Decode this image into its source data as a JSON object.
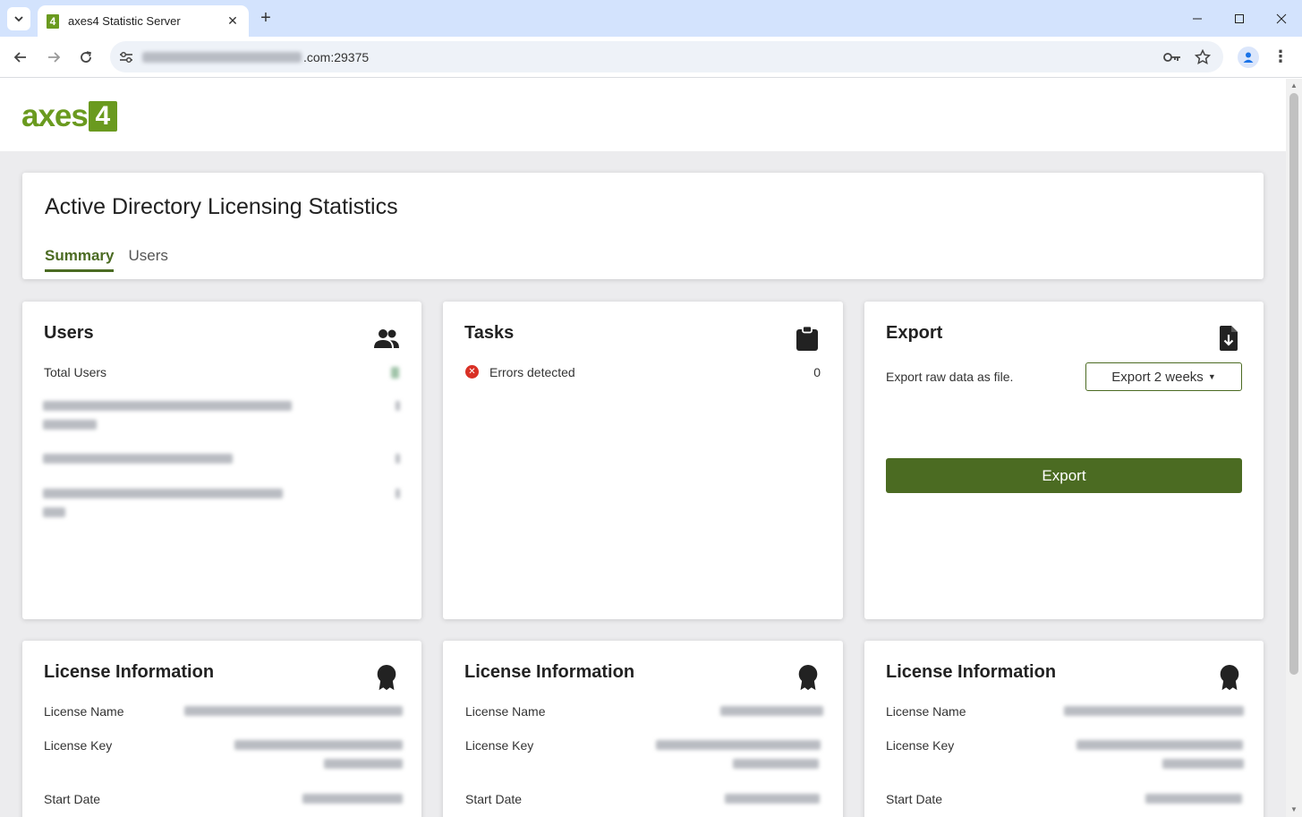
{
  "browser": {
    "tab_title": "axes4 Statistic Server",
    "new_tab": "+",
    "favicon": "4",
    "url_suffix": ".com:29375",
    "colors": {
      "tabbar": "#d3e3fd",
      "brand": "#6a9a1f"
    }
  },
  "app": {
    "logo_text": "axes",
    "logo_number": "4",
    "page_title": "Active Directory Licensing Statistics",
    "tabs": [
      {
        "label": "Summary",
        "active": true
      },
      {
        "label": "Users",
        "active": false
      }
    ]
  },
  "users_card": {
    "title": "Users",
    "total_label": "Total Users"
  },
  "tasks_card": {
    "title": "Tasks",
    "rows": [
      {
        "label": "Errors detected",
        "value": "0"
      }
    ]
  },
  "export_card": {
    "title": "Export",
    "description": "Export raw data as file.",
    "range_label": "Export 2 weeks",
    "button_label": "Export",
    "accent": "#4b6b22"
  },
  "license_cards": [
    {
      "title": "License Information",
      "name_label": "License Name",
      "key_label": "License Key",
      "start_label": "Start Date"
    },
    {
      "title": "License Information",
      "name_label": "License Name",
      "key_label": "License Key",
      "start_label": "Start Date"
    },
    {
      "title": "License Information",
      "name_label": "License Name",
      "key_label": "License Key",
      "start_label": "Start Date"
    }
  ]
}
